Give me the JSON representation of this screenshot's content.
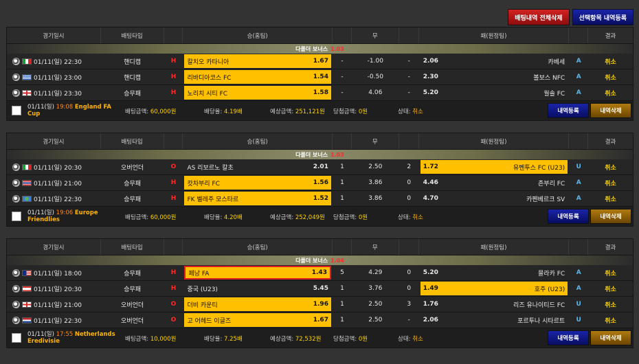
{
  "top_actions": {
    "delete_all": "배팅내역 전체삭제",
    "delete_selected": "선택항목 내역등록"
  },
  "header": {
    "date": "경기일시",
    "type": "배팅타입",
    "home": "승(홈팀)",
    "draw": "무",
    "away": "패(원정팀)",
    "result": "결과"
  },
  "bonus_label": "다폴더 보너스",
  "summary_labels": {
    "bet_amount": "배팅금액:",
    "odds": "배당율:",
    "expected": "예상금액:",
    "win": "당첨금액:",
    "status": "상태:"
  },
  "buttons": {
    "register": "내역등록",
    "delete": "내역삭제"
  },
  "slips": [
    {
      "bonus": "1.03",
      "rows": [
        {
          "flag": "it",
          "date": "01/11(일) 22:30",
          "type": "핸디캡",
          "ind": "H",
          "home": "칼치오 카타니아",
          "home_odds": "1.67",
          "home_sel": true,
          "draw_sym": "-",
          "draw_odds": "-1.00",
          "away_ind": "-",
          "away_odds": "2.06",
          "away": "카베세",
          "away_sel": false,
          "result": "A",
          "status": "취소"
        },
        {
          "flag": "gr",
          "date": "01/11(일) 23:00",
          "type": "핸디캡",
          "ind": "H",
          "home": "리바디아코스 FC",
          "home_odds": "1.54",
          "home_sel": true,
          "draw_sym": "-",
          "draw_odds": "-0.50",
          "away_ind": "-",
          "away_odds": "2.30",
          "away": "볼보스 NFC",
          "away_sel": false,
          "result": "A",
          "status": "취소"
        },
        {
          "flag": "en",
          "date": "01/11(일) 23:30",
          "type": "승무패",
          "ind": "H",
          "home": "노리치 시티 FC",
          "home_odds": "1.58",
          "home_sel": true,
          "draw_sym": "-",
          "draw_odds": "4.06",
          "away_ind": "-",
          "away_odds": "5.20",
          "away": "월솔 FC",
          "away_sel": false,
          "result": "A",
          "status": "취소"
        }
      ],
      "summary": {
        "date": "01/11(일)",
        "time": "19:08",
        "league": "England FA Cup",
        "bet": "60,000원",
        "odds": "4.19배",
        "expected": "251,121원",
        "win": "0원",
        "status": "취소"
      }
    },
    {
      "bonus": "1.03",
      "rows": [
        {
          "flag": "it",
          "date": "01/11(일) 20:30",
          "type": "오버언더",
          "ind": "O",
          "home": "AS 리보르노 칼초",
          "home_odds": "2.01",
          "home_sel": false,
          "draw_sym": "1",
          "draw_odds": "2.50",
          "away_ind": "2",
          "away_odds": "1.72",
          "away": "유벤투스 FC (U23)",
          "away_sel": true,
          "result": "U",
          "status": "취소"
        },
        {
          "flag": "th",
          "date": "01/11(일) 21:00",
          "type": "승무패",
          "ind": "H",
          "home": "캇차부리 FC",
          "home_odds": "1.56",
          "home_sel": true,
          "draw_sym": "1",
          "draw_odds": "3.86",
          "away_ind": "0",
          "away_odds": "4.46",
          "away": "촌부리 FC",
          "away_sel": false,
          "result": "A",
          "status": "취소"
        },
        {
          "flag": "wo",
          "date": "01/11(일) 22:30",
          "type": "승무패",
          "ind": "H",
          "home": "FK 벨레주 모스타르",
          "home_odds": "1.52",
          "home_sel": true,
          "draw_sym": "1",
          "draw_odds": "3.86",
          "away_ind": "0",
          "away_odds": "4.70",
          "away": "카펜베르크 SV",
          "away_sel": false,
          "result": "A",
          "status": "취소"
        }
      ],
      "summary": {
        "date": "01/11(일)",
        "time": "19:06",
        "league": "Europe Friendlies",
        "bet": "60,000원",
        "odds": "4.20배",
        "expected": "252,049원",
        "win": "0원",
        "status": "취소"
      }
    },
    {
      "bonus": "1.04",
      "rows": [
        {
          "flag": "my",
          "date": "01/11(일) 18:00",
          "type": "승무패",
          "ind": "H",
          "home": "페낭 FA",
          "home_odds": "1.43",
          "home_sel": true,
          "home_red": true,
          "draw_sym": "5",
          "draw_odds": "4.29",
          "away_ind": "0",
          "away_odds": "5.20",
          "away": "믈라카 FC",
          "away_sel": false,
          "result": "A",
          "status": "취소"
        },
        {
          "flag": "lb",
          "date": "01/11(일) 20:30",
          "type": "승무패",
          "ind": "H",
          "home": "중국 (U23)",
          "home_odds": "5.45",
          "home_sel": false,
          "draw_sym": "1",
          "draw_odds": "3.76",
          "away_ind": "0",
          "away_odds": "1.49",
          "away": "호주 (U23)",
          "away_sel": true,
          "result": "A",
          "status": "취소"
        },
        {
          "flag": "en",
          "date": "01/11(일) 21:00",
          "type": "오버언더",
          "ind": "O",
          "home": "더비 카운티",
          "home_odds": "1.96",
          "home_sel": true,
          "draw_sym": "1",
          "draw_odds": "2.50",
          "away_ind": "3",
          "away_odds": "1.76",
          "away": "리즈 유나이티드 FC",
          "away_sel": false,
          "result": "U",
          "status": "취소"
        },
        {
          "flag": "nl",
          "date": "01/11(일) 22:30",
          "type": "오버언더",
          "ind": "O",
          "home": "고 어헤드 이글즈",
          "home_odds": "1.67",
          "home_sel": true,
          "draw_sym": "1",
          "draw_odds": "2.50",
          "away_ind": "-",
          "away_odds": "2.06",
          "away": "포르투나 시타르트",
          "away_sel": false,
          "result": "U",
          "status": "취소"
        }
      ],
      "summary": {
        "date": "01/11(일)",
        "time": "17:55",
        "league": "Netherlands Eredivisie",
        "bet": "10,000원",
        "odds": "7.25배",
        "expected": "72,532원",
        "win": "0원",
        "status": "취소"
      }
    }
  ]
}
